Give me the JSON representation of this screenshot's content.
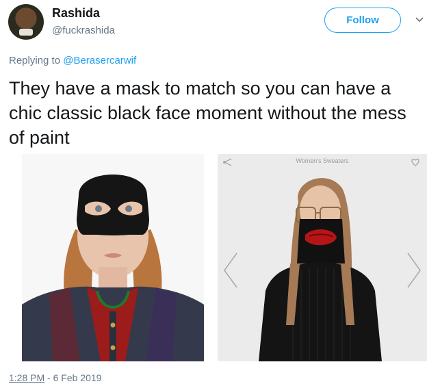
{
  "author": {
    "name": "Rashida",
    "handle": "@fuckrashida"
  },
  "follow_label": "Follow",
  "reply": {
    "prefix": "Replying to ",
    "mention": "@Berasercarwif"
  },
  "tweet": {
    "text": "They have a mask to match so you can have a chic classic black face moment without the mess of paint"
  },
  "media_right": {
    "category_label": "Women's Sweaters"
  },
  "timestamp": {
    "time": "1:28 PM",
    "separator": " - ",
    "date": "6 Feb 2019"
  },
  "icons": [
    "avatar",
    "chevron-down-icon",
    "share-icon",
    "heart-icon",
    "chevron-left-icon",
    "chevron-right-icon"
  ],
  "colors": {
    "link": "#1da1f2",
    "secondary_text": "#657786",
    "text": "#14171a"
  }
}
